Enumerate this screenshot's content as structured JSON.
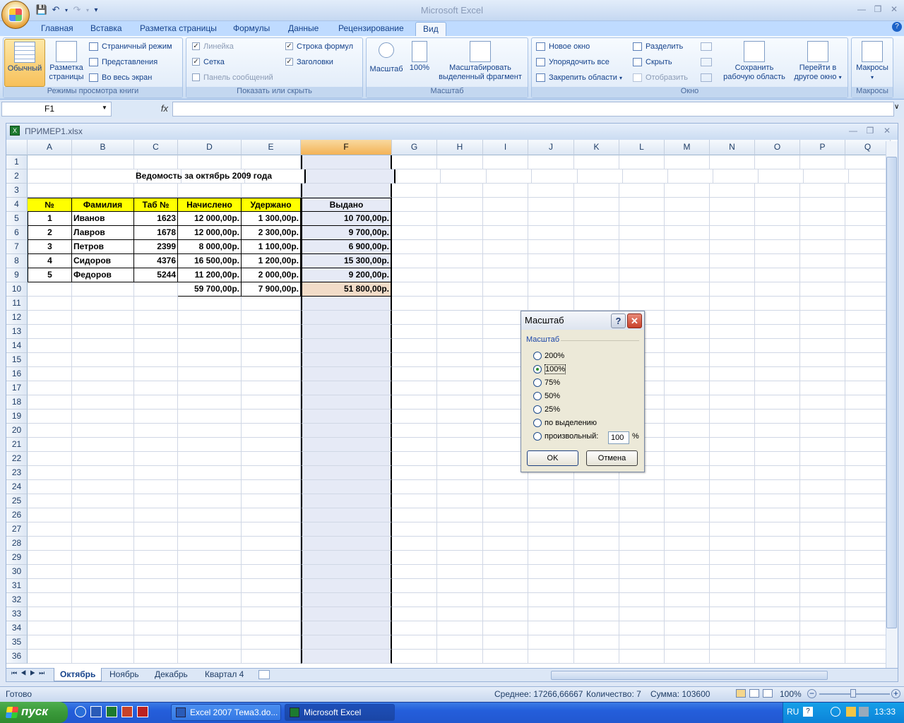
{
  "app_title": "Microsoft Excel",
  "ribbon_tabs": [
    "Главная",
    "Вставка",
    "Разметка страницы",
    "Формулы",
    "Данные",
    "Рецензирование",
    "Вид"
  ],
  "active_tab": "Вид",
  "groups": {
    "views": {
      "label": "Режимы просмотра книги",
      "normal": "Обычный",
      "page_layout": "Разметка страницы",
      "page_break": "Страничный режим",
      "custom_views": "Представления",
      "full_screen": "Во весь экран"
    },
    "show": {
      "label": "Показать или скрыть",
      "ruler": "Линейка",
      "gridlines": "Сетка",
      "message_bar": "Панель сообщений",
      "formula_bar": "Строка формул",
      "headings": "Заголовки"
    },
    "zoom": {
      "label": "Масштаб",
      "zoom": "Масштаб",
      "zoom100": "100%",
      "zoom_sel_1": "Масштабировать",
      "zoom_sel_2": "выделенный фрагмент"
    },
    "window": {
      "label": "Окно",
      "new_window": "Новое окно",
      "arrange_all": "Упорядочить все",
      "freeze": "Закрепить области",
      "split": "Разделить",
      "hide": "Скрыть",
      "unhide": "Отобразить",
      "save_ws_1": "Сохранить",
      "save_ws_2": "рабочую область",
      "switch_1": "Перейти в",
      "switch_2": "другое окно"
    },
    "macros": {
      "label": "Макросы",
      "macros": "Макросы"
    }
  },
  "name_box": "F1",
  "fx_label": "fx",
  "workbook_title": "ПРИМЕР1.xlsx",
  "columns": [
    "A",
    "B",
    "C",
    "D",
    "E",
    "F",
    "G",
    "H",
    "I",
    "J",
    "K",
    "L",
    "M",
    "N",
    "O",
    "P",
    "Q"
  ],
  "sheet": {
    "title": "Ведомость за октябрь 2009 года",
    "headers": [
      "№",
      "Фамилия",
      "Таб №",
      "Начислено",
      "Удержано",
      "Выдано"
    ],
    "rows": [
      [
        "1",
        "Иванов",
        "1623",
        "12 000,00р.",
        "1 300,00р.",
        "10 700,00р."
      ],
      [
        "2",
        "Лавров",
        "1678",
        "12 000,00р.",
        "2 300,00р.",
        "9 700,00р."
      ],
      [
        "3",
        "Петров",
        "2399",
        "8 000,00р.",
        "1 100,00р.",
        "6 900,00р."
      ],
      [
        "4",
        "Сидоров",
        "4376",
        "16 500,00р.",
        "1 200,00р.",
        "15 300,00р."
      ],
      [
        "5",
        "Федоров",
        "5244",
        "11 200,00р.",
        "2 000,00р.",
        "9 200,00р."
      ]
    ],
    "totals": [
      "59 700,00р.",
      "7 900,00р.",
      "51 800,00р."
    ]
  },
  "sheet_tabs": [
    "Октябрь",
    "Ноябрь",
    "Декабрь",
    "Квартал 4"
  ],
  "active_sheet": "Октябрь",
  "status": {
    "ready": "Готово",
    "average": "Среднее: 17266,66667",
    "count": "Количество: 7",
    "sum": "Сумма: 103600",
    "zoom": "100%"
  },
  "dialog": {
    "title": "Масштаб",
    "group": "Масштаб",
    "options": [
      "200%",
      "100%",
      "75%",
      "50%",
      "25%",
      "по выделению",
      "произвольный:"
    ],
    "selected": "100%",
    "custom_value": "100",
    "percent_sign": "%",
    "ok": "OK",
    "cancel": "Отмена"
  },
  "taskbar": {
    "start": "пуск",
    "items": [
      "Excel 2007 Тема3.do...",
      "Microsoft Excel"
    ],
    "lang": "RU",
    "clock": "13:33"
  }
}
